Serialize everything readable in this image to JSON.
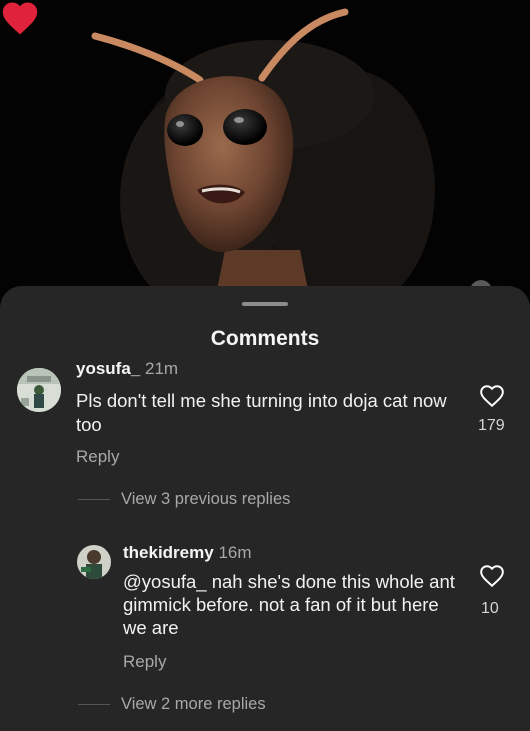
{
  "sheet": {
    "title": "Comments"
  },
  "comments": [
    {
      "username": "yosufa_",
      "time": "21m",
      "text": "Pls don't tell me she turning into doja cat now too",
      "likes": "179",
      "reply_label": "Reply",
      "view_replies": "View 3 previous replies"
    },
    {
      "username": "thekidremy",
      "time": "16m",
      "mention": "@yosufa_",
      "text": "nah she's done this whole ant gimmick before. not a fan of it but here we are",
      "likes": "10",
      "reply_label": "Reply",
      "view_replies": "View 2 more replies"
    }
  ],
  "icons": {
    "video_like": "heart-filled-icon",
    "comment_like": "heart-outline-icon"
  },
  "colors": {
    "sheet_bg": "#262626",
    "like_red": "#e0233a",
    "muted_text": "#a8a8a8"
  }
}
